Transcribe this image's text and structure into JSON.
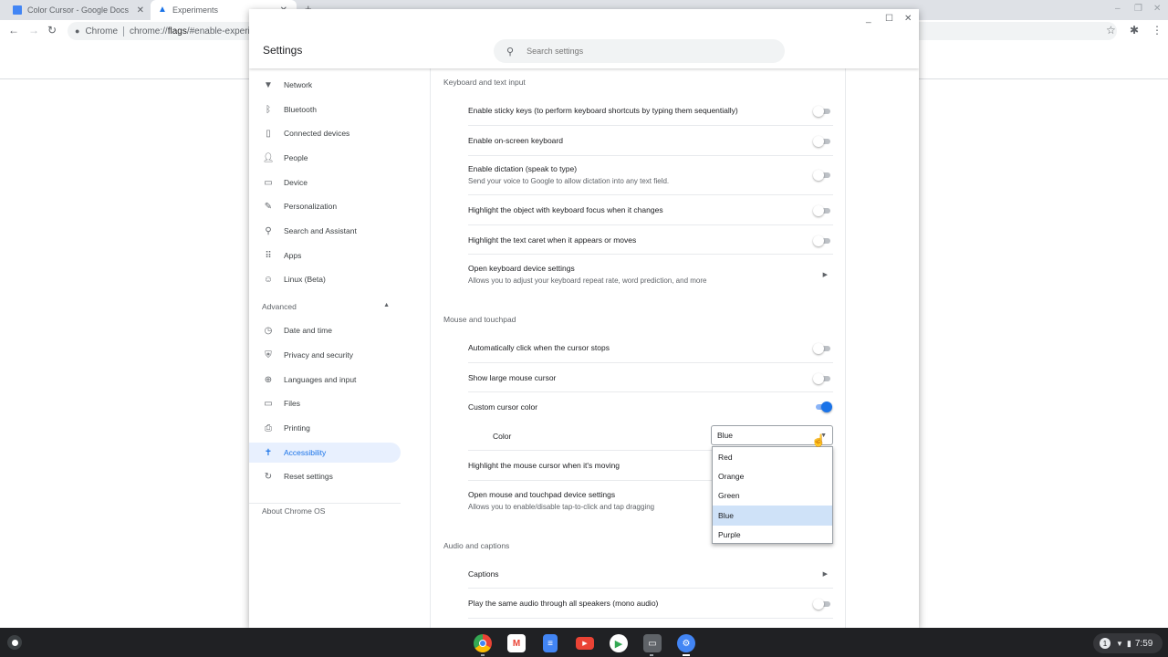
{
  "browser": {
    "tabs": [
      {
        "title": "Color Cursor - Google Docs",
        "icon": "google-docs-icon"
      },
      {
        "title": "Experiments",
        "icon": "flask-icon"
      }
    ],
    "omnibox": {
      "site": "Chrome",
      "url_prefix": "chrome://",
      "url_bold": "flags",
      "url_suffix": "/#enable-experim"
    }
  },
  "settings": {
    "title": "Settings",
    "search_placeholder": "Search settings",
    "sidebar": {
      "items": [
        {
          "label": "Network",
          "icon": "wifi-icon"
        },
        {
          "label": "Bluetooth",
          "icon": "bluetooth-icon"
        },
        {
          "label": "Connected devices",
          "icon": "phone-icon"
        },
        {
          "label": "People",
          "icon": "person-icon"
        },
        {
          "label": "Device",
          "icon": "laptop-icon"
        },
        {
          "label": "Personalization",
          "icon": "brush-icon"
        },
        {
          "label": "Search and Assistant",
          "icon": "search-icon"
        },
        {
          "label": "Apps",
          "icon": "apps-grid-icon"
        },
        {
          "label": "Linux (Beta)",
          "icon": "linux-icon"
        }
      ],
      "advanced_label": "Advanced",
      "advanced_items": [
        {
          "label": "Date and time",
          "icon": "clock-icon"
        },
        {
          "label": "Privacy and security",
          "icon": "shield-icon"
        },
        {
          "label": "Languages and input",
          "icon": "globe-icon"
        },
        {
          "label": "Files",
          "icon": "folder-icon"
        },
        {
          "label": "Printing",
          "icon": "printer-icon"
        },
        {
          "label": "Accessibility",
          "icon": "accessibility-icon",
          "active": true
        },
        {
          "label": "Reset settings",
          "icon": "reset-icon"
        }
      ],
      "about_label": "About Chrome OS"
    },
    "sections": {
      "keyboard": {
        "title": "Keyboard and text input",
        "rows": [
          {
            "label": "Enable sticky keys (to perform keyboard shortcuts by typing them sequentially)",
            "toggle": false
          },
          {
            "label": "Enable on-screen keyboard",
            "toggle": false
          },
          {
            "label": "Enable dictation (speak to type)",
            "sublabel": "Send your voice to Google to allow dictation into any text field.",
            "toggle": false
          },
          {
            "label": "Highlight the object with keyboard focus when it changes",
            "toggle": false
          },
          {
            "label": "Highlight the text caret when it appears or moves",
            "toggle": false
          },
          {
            "label": "Open keyboard device settings",
            "sublabel": "Allows you to adjust your keyboard repeat rate, word prediction, and more"
          }
        ]
      },
      "mouse": {
        "title": "Mouse and touchpad",
        "rows": [
          {
            "label": "Automatically click when the cursor stops",
            "toggle": false
          },
          {
            "label": "Show large mouse cursor",
            "toggle": false
          },
          {
            "label": "Custom cursor color",
            "toggle": true
          },
          {
            "label": "Color"
          },
          {
            "label": "Highlight the mouse cursor when it's moving"
          },
          {
            "label": "Open mouse and touchpad device settings",
            "sublabel": "Allows you to enable/disable tap-to-click and tap dragging"
          }
        ],
        "color_select": {
          "value": "Blue",
          "options": [
            "Red",
            "Orange",
            "Green",
            "Blue",
            "Purple"
          ],
          "selected": "Blue"
        }
      },
      "audio": {
        "title": "Audio and captions",
        "rows": [
          {
            "label": "Captions"
          },
          {
            "label": "Play the same audio through all speakers (mono audio)",
            "toggle": false
          }
        ]
      }
    }
  },
  "shelf": {
    "apps": [
      "Chrome",
      "Gmail",
      "Docs",
      "YouTube",
      "Play Store",
      "Chrome window",
      "Settings"
    ],
    "tray": {
      "notifications": "1",
      "time": "7:59"
    }
  },
  "colors": {
    "accent": "#1a73e8",
    "active_bg": "#e8f0fe",
    "selected_option": "#cfe2f8",
    "shelf": "#202124"
  }
}
